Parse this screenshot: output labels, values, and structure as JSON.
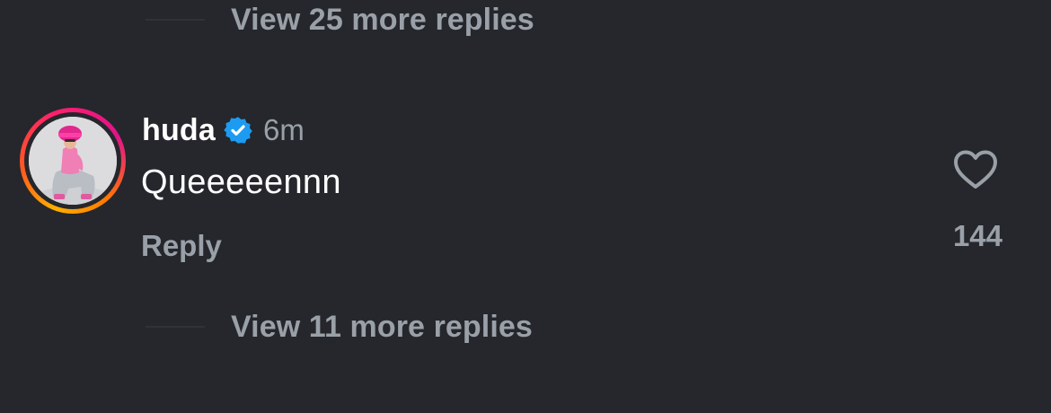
{
  "thread": {
    "more_replies_top": "View 25 more replies",
    "more_replies_bottom": "View 11 more replies"
  },
  "comment": {
    "username": "huda",
    "verified": true,
    "time": "6m",
    "text": "Queeeeennn",
    "reply_label": "Reply",
    "like_count": "144",
    "avatar_has_story_ring": true
  },
  "icons": {
    "verified": "verified-badge-icon",
    "like": "heart-outline-icon"
  },
  "colors": {
    "background": "#25272c",
    "primary_text": "#ffffff",
    "secondary_text": "#9aa0a8",
    "verified_blue": "#1d9bf0"
  }
}
